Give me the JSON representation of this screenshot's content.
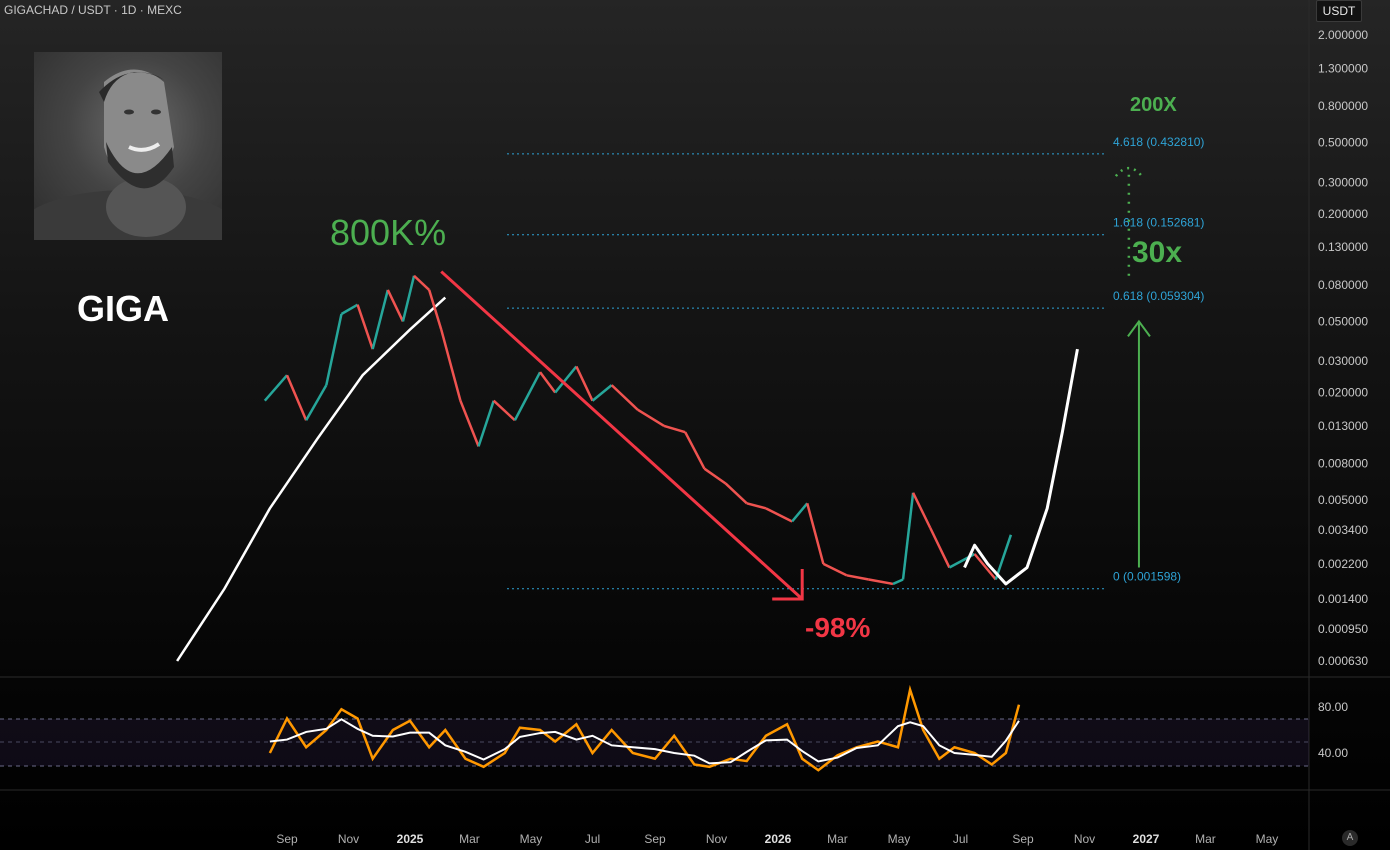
{
  "header": {
    "symbol_info": "GIGACHAD / USDT · 1D · MEXC"
  },
  "price_axis": {
    "currency": "USDT",
    "ticks": [
      "2.000000",
      "1.300000",
      "0.800000",
      "0.500000",
      "0.300000",
      "0.200000",
      "0.130000",
      "0.080000",
      "0.050000",
      "0.030000",
      "0.020000",
      "0.013000",
      "0.008000",
      "0.005000",
      "0.003400",
      "0.002200",
      "0.001400",
      "0.000950",
      "0.000630"
    ]
  },
  "rsi_axis": {
    "ticks": [
      "80.00",
      "40.00"
    ]
  },
  "time_axis": {
    "labels": [
      "Sep",
      "Nov",
      "2025",
      "Mar",
      "May",
      "Jul",
      "Sep",
      "Nov",
      "2026",
      "Mar",
      "May",
      "Jul",
      "Sep",
      "Nov",
      "2027",
      "Mar",
      "May"
    ]
  },
  "auto_button": "A",
  "overlay": {
    "ticker": "GIGA",
    "gain_label": "800K%",
    "drop_label": "-98%",
    "target_200x": "200X",
    "target_30x": "30x",
    "avatar": "gigachad-portrait"
  },
  "fib_levels": [
    {
      "label": "4.618 (0.432810)",
      "value": 0.43281
    },
    {
      "label": "1.618 (0.152681)",
      "value": 0.152681
    },
    {
      "label": "0.618 (0.059304)",
      "value": 0.059304
    },
    {
      "label": "0 (0.001598)",
      "value": 0.001598
    }
  ],
  "colors": {
    "up": "#26a69a",
    "down": "#ef5350",
    "green_text": "#4caf50",
    "red_text": "#f23645",
    "fib": "#2ea3d6",
    "rsi": "#ff9800",
    "rsi_ma": "#ffffff",
    "projection": "#ffffff"
  },
  "chart_data": {
    "type": "line",
    "scale": "log",
    "price_points": [
      {
        "x": "2024-08-10",
        "y": 0.018
      },
      {
        "x": "2024-09-01",
        "y": 0.025
      },
      {
        "x": "2024-09-20",
        "y": 0.014
      },
      {
        "x": "2024-10-10",
        "y": 0.022
      },
      {
        "x": "2024-10-25",
        "y": 0.055
      },
      {
        "x": "2024-11-10",
        "y": 0.062
      },
      {
        "x": "2024-11-25",
        "y": 0.035
      },
      {
        "x": "2024-12-10",
        "y": 0.075
      },
      {
        "x": "2024-12-25",
        "y": 0.05
      },
      {
        "x": "2025-01-05",
        "y": 0.09
      },
      {
        "x": "2025-01-20",
        "y": 0.075
      },
      {
        "x": "2025-02-01",
        "y": 0.045
      },
      {
        "x": "2025-02-20",
        "y": 0.018
      },
      {
        "x": "2025-03-10",
        "y": 0.01
      },
      {
        "x": "2025-03-25",
        "y": 0.018
      },
      {
        "x": "2025-04-15",
        "y": 0.014
      },
      {
        "x": "2025-05-10",
        "y": 0.026
      },
      {
        "x": "2025-05-25",
        "y": 0.02
      },
      {
        "x": "2025-06-15",
        "y": 0.028
      },
      {
        "x": "2025-07-01",
        "y": 0.018
      },
      {
        "x": "2025-07-20",
        "y": 0.022
      },
      {
        "x": "2025-08-15",
        "y": 0.016
      },
      {
        "x": "2025-09-10",
        "y": 0.013
      },
      {
        "x": "2025-10-01",
        "y": 0.012
      },
      {
        "x": "2025-10-20",
        "y": 0.0075
      },
      {
        "x": "2025-11-10",
        "y": 0.0062
      },
      {
        "x": "2025-12-01",
        "y": 0.0048
      },
      {
        "x": "2025-12-20",
        "y": 0.0045
      },
      {
        "x": "2026-01-15",
        "y": 0.0038
      },
      {
        "x": "2026-01-30",
        "y": 0.0048
      },
      {
        "x": "2026-02-15",
        "y": 0.0022
      },
      {
        "x": "2026-03-10",
        "y": 0.0019
      },
      {
        "x": "2026-04-01",
        "y": 0.0018
      },
      {
        "x": "2026-04-25",
        "y": 0.0017
      },
      {
        "x": "2026-05-05",
        "y": 0.0018
      },
      {
        "x": "2026-05-15",
        "y": 0.0055
      },
      {
        "x": "2026-06-01",
        "y": 0.0035
      },
      {
        "x": "2026-06-20",
        "y": 0.0021
      },
      {
        "x": "2026-07-15",
        "y": 0.0025
      },
      {
        "x": "2026-08-05",
        "y": 0.0018
      },
      {
        "x": "2026-08-20",
        "y": 0.0032
      }
    ],
    "arc_curve": [
      {
        "x": "2024-05-15",
        "y": 0.00063
      },
      {
        "x": "2024-07-01",
        "y": 0.0016
      },
      {
        "x": "2024-08-15",
        "y": 0.0045
      },
      {
        "x": "2024-10-01",
        "y": 0.011
      },
      {
        "x": "2024-11-15",
        "y": 0.025
      },
      {
        "x": "2025-01-01",
        "y": 0.045
      },
      {
        "x": "2025-02-05",
        "y": 0.068
      }
    ],
    "projection_path": [
      {
        "x": "2026-07-05",
        "y": 0.0021
      },
      {
        "x": "2026-07-15",
        "y": 0.0028
      },
      {
        "x": "2026-07-28",
        "y": 0.0022
      },
      {
        "x": "2026-08-15",
        "y": 0.0017
      },
      {
        "x": "2026-09-05",
        "y": 0.0021
      },
      {
        "x": "2026-09-25",
        "y": 0.0045
      },
      {
        "x": "2026-10-10",
        "y": 0.012
      },
      {
        "x": "2026-10-25",
        "y": 0.035
      }
    ],
    "down_arrow": {
      "from": {
        "x": "2025-02-01",
        "y": 0.095
      },
      "to": {
        "x": "2026-01-25",
        "y": 0.0014
      }
    },
    "up_arrow": {
      "from": {
        "x": "2026-12-25",
        "y": 0.0021
      },
      "to": {
        "x": "2026-12-25",
        "y": 0.05
      }
    },
    "dotted_target": {
      "from": {
        "x": "2026-12-15",
        "y": 0.09
      },
      "to": {
        "x": "2026-12-15",
        "y": 0.36
      }
    },
    "rsi": {
      "range": [
        0,
        120
      ],
      "levels": [
        70,
        30
      ],
      "values": [
        {
          "x": "2024-08-15",
          "y": 40
        },
        {
          "x": "2024-09-01",
          "y": 70
        },
        {
          "x": "2024-09-20",
          "y": 45
        },
        {
          "x": "2024-10-10",
          "y": 60
        },
        {
          "x": "2024-10-25",
          "y": 78
        },
        {
          "x": "2024-11-10",
          "y": 70
        },
        {
          "x": "2024-11-25",
          "y": 35
        },
        {
          "x": "2024-12-15",
          "y": 60
        },
        {
          "x": "2025-01-01",
          "y": 68
        },
        {
          "x": "2025-01-20",
          "y": 45
        },
        {
          "x": "2025-02-05",
          "y": 60
        },
        {
          "x": "2025-02-25",
          "y": 35
        },
        {
          "x": "2025-03-15",
          "y": 28
        },
        {
          "x": "2025-04-05",
          "y": 40
        },
        {
          "x": "2025-04-20",
          "y": 62
        },
        {
          "x": "2025-05-10",
          "y": 60
        },
        {
          "x": "2025-05-25",
          "y": 50
        },
        {
          "x": "2025-06-15",
          "y": 65
        },
        {
          "x": "2025-07-01",
          "y": 40
        },
        {
          "x": "2025-07-20",
          "y": 60
        },
        {
          "x": "2025-08-10",
          "y": 40
        },
        {
          "x": "2025-09-01",
          "y": 35
        },
        {
          "x": "2025-09-20",
          "y": 55
        },
        {
          "x": "2025-10-10",
          "y": 30
        },
        {
          "x": "2025-10-25",
          "y": 28
        },
        {
          "x": "2025-11-15",
          "y": 35
        },
        {
          "x": "2025-12-01",
          "y": 33
        },
        {
          "x": "2025-12-20",
          "y": 55
        },
        {
          "x": "2026-01-10",
          "y": 65
        },
        {
          "x": "2026-01-25",
          "y": 35
        },
        {
          "x": "2026-02-10",
          "y": 25
        },
        {
          "x": "2026-03-01",
          "y": 38
        },
        {
          "x": "2026-03-20",
          "y": 45
        },
        {
          "x": "2026-04-10",
          "y": 50
        },
        {
          "x": "2026-04-30",
          "y": 45
        },
        {
          "x": "2026-05-12",
          "y": 95
        },
        {
          "x": "2026-05-25",
          "y": 60
        },
        {
          "x": "2026-06-10",
          "y": 35
        },
        {
          "x": "2026-06-25",
          "y": 45
        },
        {
          "x": "2026-07-15",
          "y": 40
        },
        {
          "x": "2026-08-01",
          "y": 30
        },
        {
          "x": "2026-08-15",
          "y": 40
        },
        {
          "x": "2026-08-28",
          "y": 82
        }
      ]
    }
  }
}
